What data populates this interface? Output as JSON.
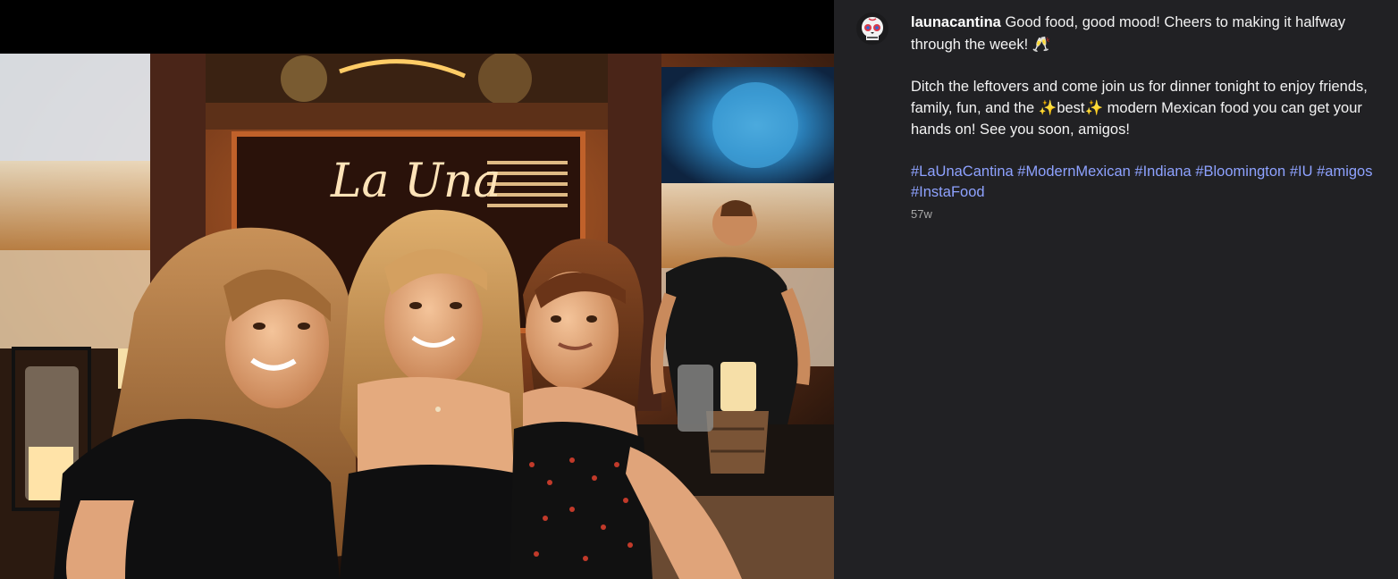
{
  "post": {
    "username": "launacantina",
    "caption_line1": "Good food, good mood! Cheers to making it halfway through the week! ",
    "caption_line1_emoji": "🥂",
    "caption_para2_a": "Ditch the leftovers and come join us for dinner tonight to enjoy friends, family, fun, and the ",
    "caption_para2_sparkle1": "✨",
    "caption_para2_best": "best",
    "caption_para2_sparkle2": "✨",
    "caption_para2_b": " modern Mexican food you can get your hands on! See you soon, amigos!",
    "hashtags": [
      "#LaUnaCantina",
      "#ModernMexican",
      "#Indiana",
      "#Bloomington",
      "#IU",
      "#amigos",
      "#InstaFood"
    ],
    "timestamp": "57w"
  },
  "photo": {
    "neon_sign_text": "La Una"
  },
  "colors": {
    "panel_bg": "#212124",
    "hashtag": "#8ea2ff",
    "timestamp": "#a8a8a8",
    "neon": "#ffe3b8"
  },
  "icons": {
    "avatar": "sugar-skull-icon"
  }
}
